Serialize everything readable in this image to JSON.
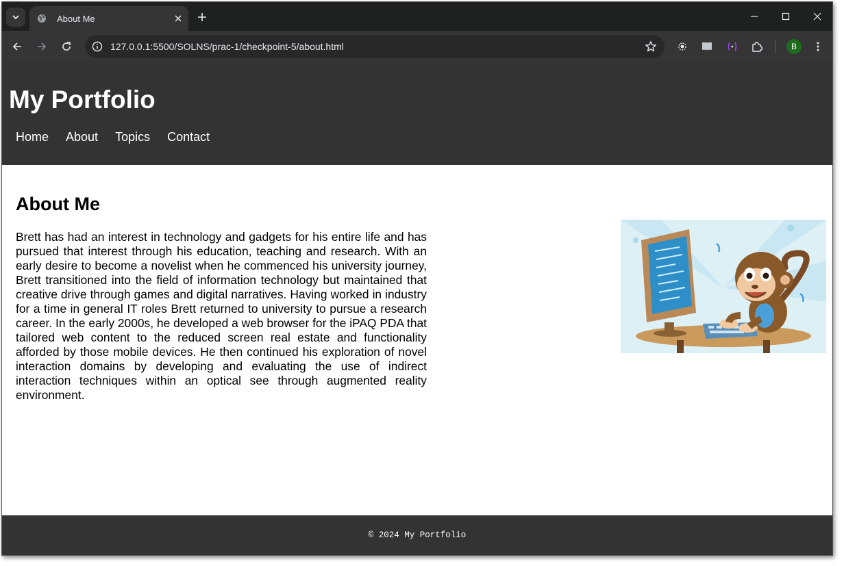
{
  "browser": {
    "tab": {
      "title": "About Me"
    },
    "address_bar": {
      "url_host": "127.0.0.1",
      "url_path": ":5500/SOLNS/prac-1/checkpoint-5/about.html"
    },
    "profile_initial": "B"
  },
  "site": {
    "title": "My Portfolio",
    "nav": [
      "Home",
      "About",
      "Topics",
      "Contact"
    ]
  },
  "main": {
    "heading": "About Me",
    "bio": "Brett has had an interest in technology and gadgets for his entire life and has pursued that interest through his education, teaching and research. With an early desire to become a novelist when he commenced his university journey, Brett transitioned into the field of information technology but maintained that creative drive through games and digital narratives. Having worked in industry for a time in general IT roles Brett returned to university to pursue a research career. In the early 2000s, he developed a web browser for the iPAQ PDA that tailored web content to the reduced screen real estate and functionality afforded by those mobile devices. He then continued his exploration of novel interaction domains by developing and evaluating the use of indirect interaction techniques within an optical see through augmented reality environment."
  },
  "footer": {
    "text": "© 2024 My Portfolio"
  },
  "colors": {
    "header_bg": "#333333",
    "tab_strip": "#1f2020",
    "toolbar": "#353535",
    "omnibox": "#282828"
  }
}
